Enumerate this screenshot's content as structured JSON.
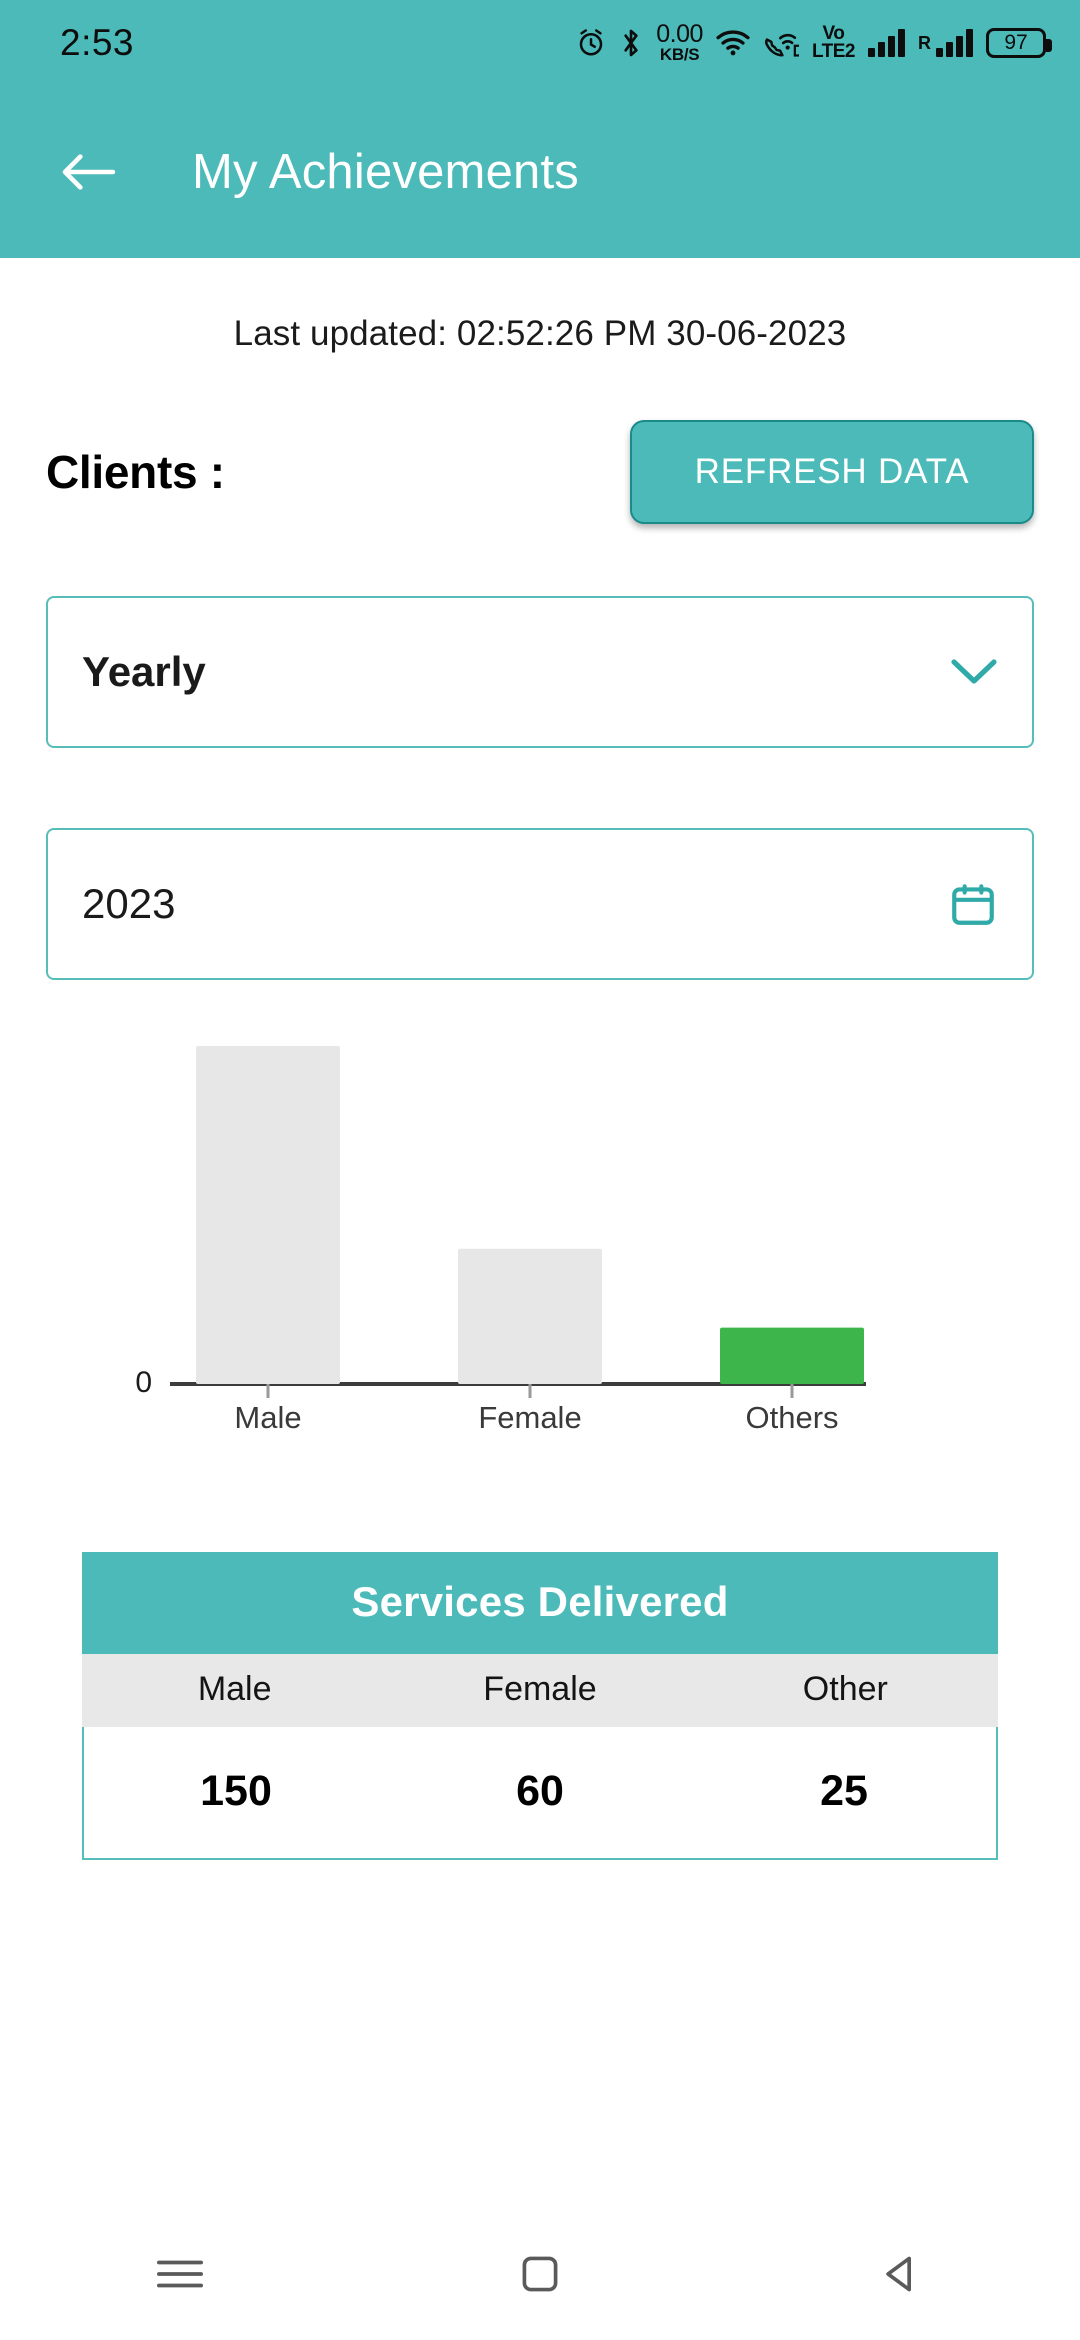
{
  "status_bar": {
    "time": "2:53",
    "net_speed_value": "0.00",
    "net_speed_unit": "KB/S",
    "volte_top": "Vo",
    "volte_bottom": "LTE2",
    "roaming_label": "R",
    "battery_percent": "97",
    "icons": [
      "alarm-icon",
      "bluetooth-icon",
      "network-speed-indicator",
      "wifi-icon",
      "vowifi-icon",
      "volte-icon",
      "signal-bars-icon",
      "roaming-signal-icon",
      "battery-icon"
    ]
  },
  "app_bar": {
    "back_icon": "back-arrow-icon",
    "title": "My Achievements"
  },
  "main": {
    "last_updated": "Last updated: 02:52:26 PM 30-06-2023",
    "section_label": "Clients :",
    "refresh_label": "REFRESH DATA",
    "period_select": {
      "value": "Yearly",
      "icon": "chevron-down-icon"
    },
    "year_field": {
      "value": "2023",
      "icon": "calendar-icon"
    }
  },
  "chart_data": {
    "type": "bar",
    "categories": [
      "Male",
      "Female",
      "Others"
    ],
    "values": [
      150,
      60,
      25
    ],
    "colors": [
      "#e7e7e7",
      "#e7e7e7",
      "#3db54a"
    ],
    "title": "",
    "xlabel": "",
    "ylabel": "",
    "ylim": [
      0,
      150
    ],
    "y_tick_labels": [
      "0"
    ],
    "grid": false,
    "legend": false
  },
  "table": {
    "title": "Services Delivered",
    "columns": [
      "Male",
      "Female",
      "Other"
    ],
    "values": [
      "150",
      "60",
      "25"
    ]
  },
  "nav_bar": {
    "items": [
      "recents-menu-icon",
      "home-icon",
      "back-nav-icon"
    ]
  },
  "colors": {
    "primary_teal": "#4BBAB9",
    "border_teal": "#56bdbb",
    "bar_gray": "#e7e7e7",
    "bar_green": "#3db54a"
  }
}
